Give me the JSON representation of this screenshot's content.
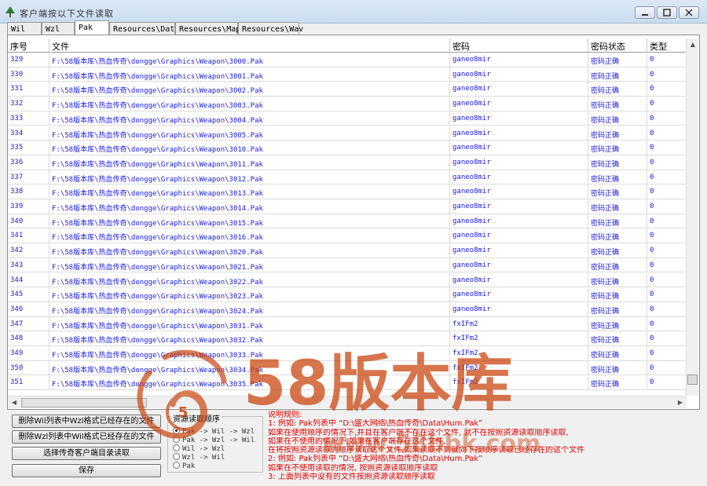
{
  "window": {
    "title": "客户端按以下文件读取"
  },
  "tabs": [
    {
      "label": "Wil"
    },
    {
      "label": "Wzl"
    },
    {
      "label": "Pak"
    },
    {
      "label": "Resources\\Data"
    },
    {
      "label": "Resources\\Map"
    },
    {
      "label": "Resources\\Wav"
    }
  ],
  "active_tab": 2,
  "columns": [
    "序号",
    "文件",
    "密码",
    "密码状态",
    "类型"
  ],
  "rows": [
    [
      "329",
      "F:\\58版本库\\热血传奇\\dongge\\Graphics\\Weapon\\3000.Pak",
      "ganeo8mir",
      "密码正确",
      "0"
    ],
    [
      "330",
      "F:\\58版本库\\热血传奇\\dongge\\Graphics\\Weapon\\3001.Pak",
      "ganeo8mir",
      "密码正确",
      "0"
    ],
    [
      "331",
      "F:\\58版本库\\热血传奇\\dongge\\Graphics\\Weapon\\3002.Pak",
      "ganeo8mir",
      "密码正确",
      "0"
    ],
    [
      "332",
      "F:\\58版本库\\热血传奇\\dongge\\Graphics\\Weapon\\3003.Pak",
      "ganeo8mir",
      "密码正确",
      "0"
    ],
    [
      "333",
      "F:\\58版本库\\热血传奇\\dongge\\Graphics\\Weapon\\3004.Pak",
      "ganeo8mir",
      "密码正确",
      "0"
    ],
    [
      "334",
      "F:\\58版本库\\热血传奇\\dongge\\Graphics\\Weapon\\3005.Pak",
      "ganeo8mir",
      "密码正确",
      "0"
    ],
    [
      "335",
      "F:\\58版本库\\热血传奇\\dongge\\Graphics\\Weapon\\3010.Pak",
      "ganeo8mir",
      "密码正确",
      "0"
    ],
    [
      "336",
      "F:\\58版本库\\热血传奇\\dongge\\Graphics\\Weapon\\3011.Pak",
      "ganeo8mir",
      "密码正确",
      "0"
    ],
    [
      "337",
      "F:\\58版本库\\热血传奇\\dongge\\Graphics\\Weapon\\3012.Pak",
      "ganeo8mir",
      "密码正确",
      "0"
    ],
    [
      "338",
      "F:\\58版本库\\热血传奇\\dongge\\Graphics\\Weapon\\3013.Pak",
      "ganeo8mir",
      "密码正确",
      "0"
    ],
    [
      "339",
      "F:\\58版本库\\热血传奇\\dongge\\Graphics\\Weapon\\3014.Pak",
      "ganeo8mir",
      "密码正确",
      "0"
    ],
    [
      "340",
      "F:\\58版本库\\热血传奇\\dongge\\Graphics\\Weapon\\3015.Pak",
      "ganeo8mir",
      "密码正确",
      "0"
    ],
    [
      "341",
      "F:\\58版本库\\热血传奇\\dongge\\Graphics\\Weapon\\3016.Pak",
      "ganeo8mir",
      "密码正确",
      "0"
    ],
    [
      "342",
      "F:\\58版本库\\热血传奇\\dongge\\Graphics\\Weapon\\3020.Pak",
      "ganeo8mir",
      "密码正确",
      "0"
    ],
    [
      "343",
      "F:\\58版本库\\热血传奇\\dongge\\Graphics\\Weapon\\3021.Pak",
      "ganeo8mir",
      "密码正确",
      "0"
    ],
    [
      "344",
      "F:\\58版本库\\热血传奇\\dongge\\Graphics\\Weapon\\3022.Pak",
      "ganeo8mir",
      "密码正确",
      "0"
    ],
    [
      "345",
      "F:\\58版本库\\热血传奇\\dongge\\Graphics\\Weapon\\3023.Pak",
      "ganeo8mir",
      "密码正确",
      "0"
    ],
    [
      "346",
      "F:\\58版本库\\热血传奇\\dongge\\Graphics\\Weapon\\3024.Pak",
      "ganeo8mir",
      "密码正确",
      "0"
    ],
    [
      "347",
      "F:\\58版本库\\热血传奇\\dongge\\Graphics\\Weapon\\3031.Pak",
      "fxIFm2",
      "密码正确",
      "0"
    ],
    [
      "348",
      "F:\\58版本库\\热血传奇\\dongge\\Graphics\\Weapon\\3032.Pak",
      "fxIFm2",
      "密码正确",
      "0"
    ],
    [
      "349",
      "F:\\58版本库\\热血传奇\\dongge\\Graphics\\Weapon\\3033.Pak",
      "fxIFm2",
      "密码正确",
      "0"
    ],
    [
      "350",
      "F:\\58版本库\\热血传奇\\dongge\\Graphics\\Weapon\\3034.Pak",
      "fxIFm2",
      "密码正确",
      "0"
    ],
    [
      "351",
      "F:\\58版本库\\热血传奇\\dongge\\Graphics\\Weapon\\3035.Pak",
      "fxIFm2",
      "密码正确",
      "0"
    ]
  ],
  "buttons": {
    "delete_wil": "删除Wil列表中Wzl格式已经存在的文件",
    "delete_wzl": "删除Wzl列表中Wil格式已经存在的文件",
    "select_client": "选择传奇客户端目录读取",
    "save": "保存"
  },
  "load_order": {
    "title": "资源读取顺序",
    "options": [
      "Pak -> Wil -> Wzl",
      "Pak -> Wzl -> Wil",
      "Wil -> Wzl",
      "Wzl -> Wil",
      "Pak"
    ],
    "selected": 0
  },
  "notes": {
    "title": "说明规则:",
    "lines": [
      "1: 例如: Pak列表中 “D:\\盛大网络\\热血传奇\\Data\\Hum.Pak”",
      "   如果在使用顺序的情况下,并且在客户端不存在这个文件, 就不在按照资源读取顺序读取,",
      "   如果在不使用的情况下,如果在客户端存在这个文件,",
      "   在将按照资源读取的顺序读取这个文件,如果读取不到就向下按顺序读取已经存在的这个文件",
      "2: 例如: Pak列表中 “D:\\盛大网络\\热血传奇\\Data\\Hum.Pak”",
      "   如果在不使用读取的情况, 按照资源读取顺序读取",
      "3: 上面列表中没有的文件按照资源读取顺序读取"
    ]
  },
  "watermark": {
    "text": "58版本库",
    "sub": "www.58bbk.com"
  },
  "colors": {
    "text_blue": "#1a1ae0",
    "note_red": "#e00000",
    "watermark": "#c8410a"
  }
}
